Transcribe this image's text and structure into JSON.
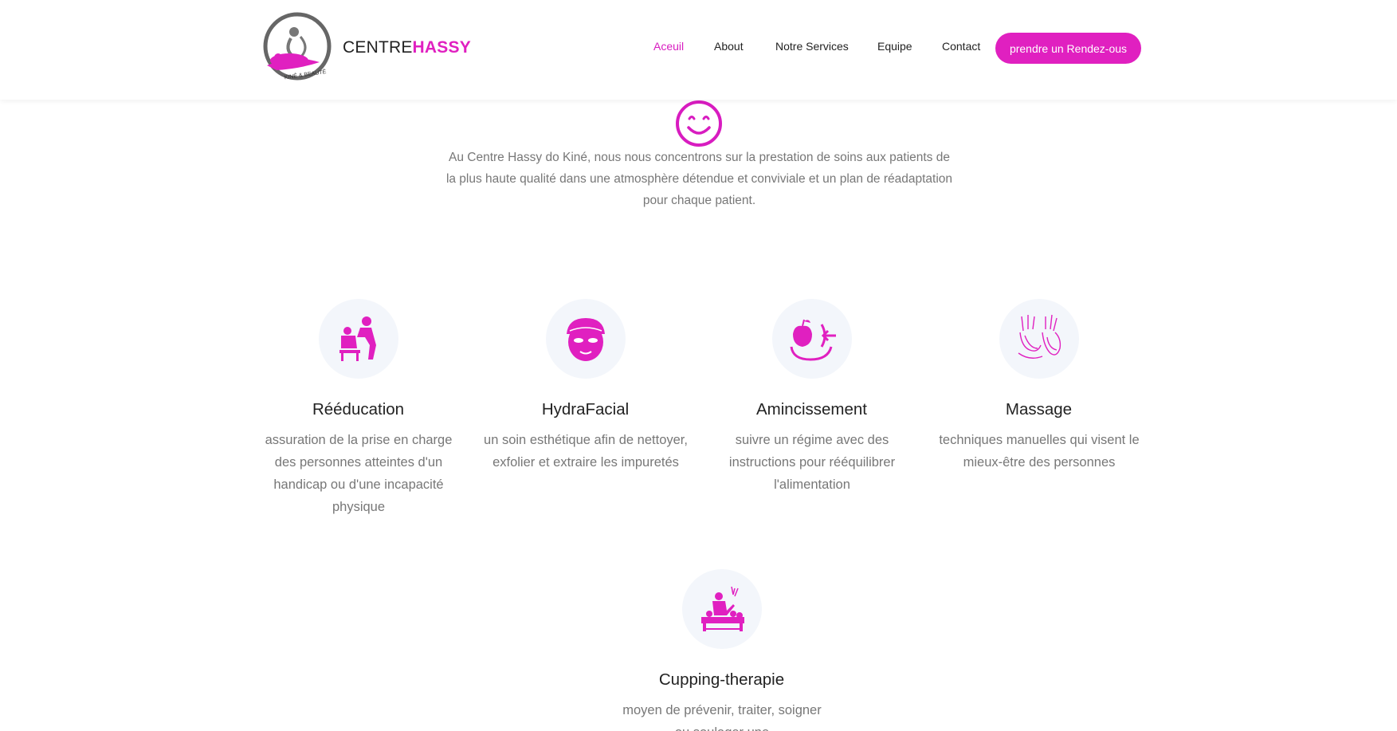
{
  "header": {
    "brand_part1": "CENTRE",
    "brand_part2": "HASSY",
    "logo_text": "KINÉ & BEAUTÉ",
    "nav": [
      "Aceuil",
      "About",
      "Notre Services",
      "Equipe",
      "Contact"
    ],
    "active_nav": "Aceuil",
    "cta_label": "prendre un Rendez-ous"
  },
  "intro": {
    "text": "Au Centre Hassy do Kiné, nous nous concentrons sur la prestation de soins aux patients de la plus haute qualité dans une atmosphère détendue et conviviale et un plan de réadaptation pour chaque patient."
  },
  "services": [
    {
      "title": "Rééducation",
      "description": "assuration de la prise en charge des personnes atteintes d'un handicap ou d'une incapacité physique",
      "icon": "rehabilitation-icon"
    },
    {
      "title": "HydraFacial",
      "description": "un soin esthétique afin de nettoyer, exfolier et extraire les impuretés",
      "icon": "face-mask-icon"
    },
    {
      "title": "Amincissement",
      "description": "suivre un régime avec des instructions pour rééquilibrer l'alimentation",
      "icon": "slimming-icon"
    },
    {
      "title": "Massage",
      "description": "techniques manuelles qui visent le mieux-être des personnes",
      "icon": "massage-hands-icon"
    },
    {
      "title": "Cupping-therapie",
      "description": "moyen de prévenir, traiter, soigner ou soulager une",
      "icon": "cupping-icon"
    }
  ],
  "colors": {
    "accent": "#e020c0",
    "text_dark": "#222222",
    "text_muted": "#777777",
    "icon_bg": "#f3f6fb"
  }
}
